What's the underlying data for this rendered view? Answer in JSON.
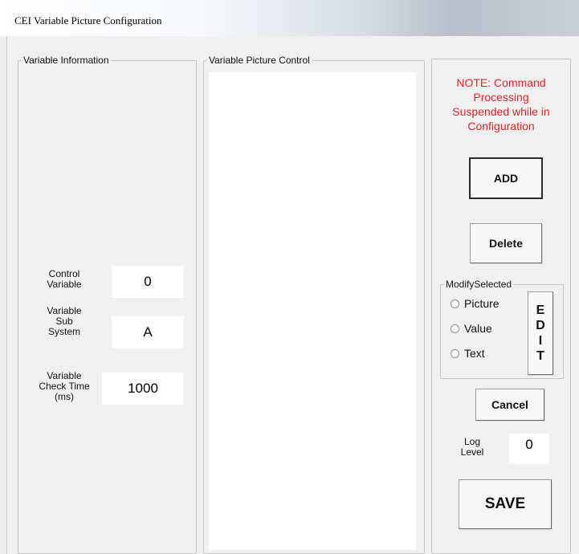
{
  "window": {
    "title": "CEI  Variable Picture  Configuration"
  },
  "variable_information": {
    "legend": "Variable Information",
    "control_variable": {
      "label_line1": "Control",
      "label_line2": "Variable",
      "value": "0"
    },
    "sub_system": {
      "label_line1": "Variable",
      "label_line2": "Sub",
      "label_line3": "System",
      "value": "A"
    },
    "check_time": {
      "label_line1": "Variable",
      "label_line2": "Check Time",
      "label_line3": "(ms)",
      "value": "1000"
    }
  },
  "picture_control": {
    "legend": "Variable Picture Control"
  },
  "right_panel": {
    "note_line1": "NOTE: Command",
    "note_line2": "Processing",
    "note_line3": "Suspended while in",
    "note_line4": "Configuration",
    "add_label": "ADD",
    "delete_label": "Delete",
    "modify_selected": {
      "legend": "ModifySelected",
      "options": [
        "Picture",
        "Value",
        "Text"
      ],
      "edit_letters": [
        "E",
        "D",
        "I",
        "T"
      ]
    },
    "cancel_label": "Cancel",
    "log_level": {
      "label_line1": "Log",
      "label_line2": "Level",
      "value": "0"
    },
    "save_label": "SAVE"
  },
  "colors": {
    "note_text": "#e21f26",
    "panel_bg": "#f0f0f0"
  }
}
